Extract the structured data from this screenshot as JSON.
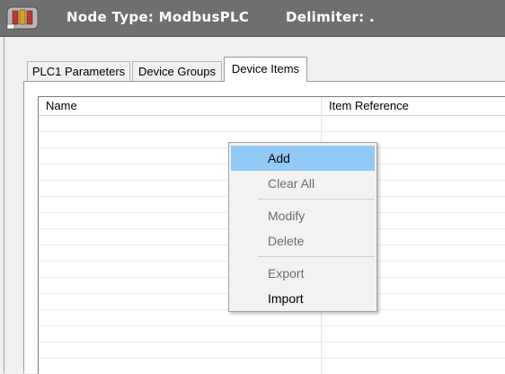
{
  "header": {
    "node_type": "Node Type: ModbusPLC",
    "delimiter": "Delimiter: ."
  },
  "tabs": [
    {
      "label": "PLC1 Parameters",
      "active": false
    },
    {
      "label": "Device Groups",
      "active": false
    },
    {
      "label": "Device Items",
      "active": true
    }
  ],
  "list": {
    "columns": [
      "Name",
      "Item Reference"
    ],
    "rows": []
  },
  "context_menu": {
    "items": [
      {
        "label": "Add",
        "enabled": true,
        "highlighted": true
      },
      {
        "label": "Clear All",
        "enabled": false
      },
      {
        "label": "Modify",
        "enabled": false
      },
      {
        "label": "Delete",
        "enabled": false
      },
      {
        "label": "Export",
        "enabled": false
      },
      {
        "label": "Import",
        "enabled": true
      }
    ]
  },
  "icons": {
    "header": "device-node-icon"
  },
  "colors": {
    "header_bg": "#6f6f6f",
    "menu_highlight": "#91c9f7",
    "disabled_text": "#6d6d6d"
  }
}
